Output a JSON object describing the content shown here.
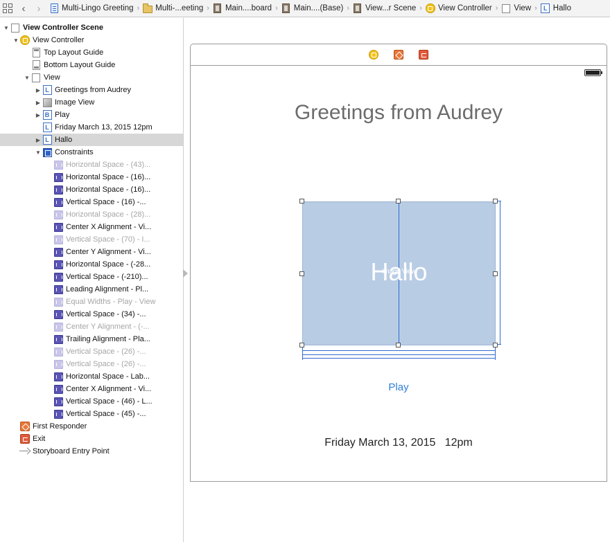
{
  "jumpbar": {
    "crumbs": [
      {
        "icon": "file-icon",
        "label": "Multi-Lingo Greeting"
      },
      {
        "icon": "folder-icon",
        "label": "Multi-...eeting"
      },
      {
        "icon": "storyboard-icon",
        "label": "Main....board"
      },
      {
        "icon": "storyboard-icon",
        "label": "Main....(Base)"
      },
      {
        "icon": "storyboard-icon",
        "label": "View...r Scene"
      },
      {
        "icon": "view-controller-icon",
        "label": "View Controller"
      },
      {
        "icon": "view-icon",
        "label": "View"
      },
      {
        "icon": "label-icon",
        "label": "Hallo"
      }
    ],
    "separator": "›"
  },
  "outline": {
    "scene": "View Controller Scene",
    "view_controller": "View Controller",
    "top_layout_guide": "Top Layout Guide",
    "bottom_layout_guide": "Bottom Layout Guide",
    "view": "View",
    "greetings_label": "Greetings from Audrey",
    "image_view": "Image View",
    "play_button": "Play",
    "date_label": "Friday March 13, 2015   12pm",
    "hallo_label": "Hallo",
    "constraints_group": "Constraints",
    "constraints": [
      {
        "label": "Horizontal Space - (43)...",
        "dim": true
      },
      {
        "label": "Horizontal Space - (16)...",
        "dim": false
      },
      {
        "label": "Horizontal Space - (16)...",
        "dim": false
      },
      {
        "label": "Vertical Space - (16) -...",
        "dim": false
      },
      {
        "label": "Horizontal Space - (28)...",
        "dim": true
      },
      {
        "label": "Center X Alignment - Vi...",
        "dim": false
      },
      {
        "label": "Vertical Space - (70) - I...",
        "dim": true
      },
      {
        "label": "Center Y Alignment - Vi...",
        "dim": false
      },
      {
        "label": "Horizontal Space - (-28...",
        "dim": false
      },
      {
        "label": "Vertical Space - (-210)...",
        "dim": false
      },
      {
        "label": "Leading Alignment - Pl...",
        "dim": false
      },
      {
        "label": "Equal Widths - Play - View",
        "dim": true
      },
      {
        "label": "Vertical Space - (34) -...",
        "dim": false
      },
      {
        "label": "Center Y Alignment - (-...",
        "dim": true
      },
      {
        "label": "Trailing Alignment - Pla...",
        "dim": false
      },
      {
        "label": "Vertical Space - (26) -...",
        "dim": true
      },
      {
        "label": "Vertical Space - (26) -...",
        "dim": true
      },
      {
        "label": "Horizontal Space - Lab...",
        "dim": false
      },
      {
        "label": "Center X Alignment - Vi...",
        "dim": false
      },
      {
        "label": "Vertical Space - (46) - L...",
        "dim": false
      },
      {
        "label": "Vertical Space - (45) -...",
        "dim": false
      }
    ],
    "first_responder": "First Responder",
    "exit": "Exit",
    "entry_point": "Storyboard Entry Point"
  },
  "canvas": {
    "greeting_text": "Greetings from Audrey",
    "image_view_text": "Hallo",
    "image_view_caption": "Image View",
    "play_text": "Play",
    "date_text": "Friday March 13, 2015   12pm"
  },
  "colors": {
    "selection": "#d7d7d7",
    "accent_blue": "#2f7ed8",
    "image_view_fill": "#b8cce4",
    "constraint": "#5a55b5"
  }
}
